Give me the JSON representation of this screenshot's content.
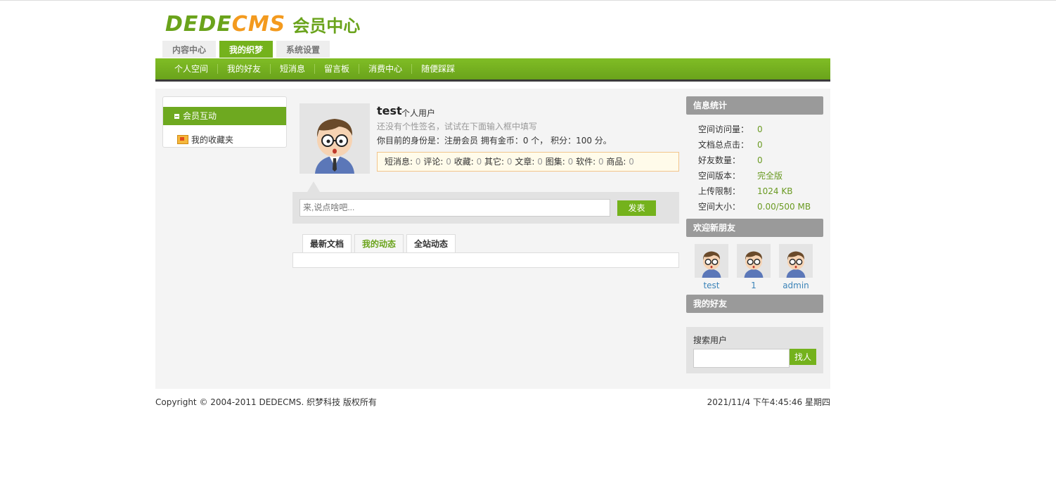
{
  "logo": {
    "part1": "DEDE",
    "part2": "CMS",
    "cn": "会员中心"
  },
  "tabs": [
    {
      "label": "内容中心"
    },
    {
      "label": "我的织梦"
    },
    {
      "label": "系统设置"
    }
  ],
  "subnav": [
    "个人空间",
    "我的好友",
    "短消息",
    "留言板",
    "消费中心",
    "随便踩踩"
  ],
  "left": {
    "section": "会员互动",
    "favorites": "我的收藏夹"
  },
  "profile": {
    "name": "test",
    "type": "个人用户",
    "sign": "还没有个性签名，试试在下面输入框中填写",
    "info": "你目前的身份是：注册会员 拥有金币：0 个，  积分：100 分。",
    "stats": [
      {
        "label": "短消息:",
        "value": "0"
      },
      {
        "label": "评论:",
        "value": "0"
      },
      {
        "label": "收藏:",
        "value": "0"
      },
      {
        "label": "其它:",
        "value": "0"
      },
      {
        "label": "文章:",
        "value": "0"
      },
      {
        "label": "图集:",
        "value": "0"
      },
      {
        "label": "软件:",
        "value": "0"
      },
      {
        "label": "商品:",
        "value": "0"
      }
    ]
  },
  "post": {
    "placeholder": "来,说点啥吧...",
    "button": "发表"
  },
  "content_tabs": [
    {
      "label": "最新文档"
    },
    {
      "label": "我的动态"
    },
    {
      "label": "全站动态"
    }
  ],
  "info_stats": {
    "title": "信息统计",
    "rows": [
      {
        "key": "空间访问量：",
        "value": "0"
      },
      {
        "key": "文档总点击：",
        "value": "0"
      },
      {
        "key": "好友数量：",
        "value": "0"
      },
      {
        "key": "空间版本：",
        "value": "完全版"
      },
      {
        "key": "上传限制：",
        "value": "1024 KB"
      },
      {
        "key": "空间大小：",
        "value": "0.00/500 MB"
      }
    ]
  },
  "new_friends": {
    "title": "欢迎新朋友",
    "items": [
      {
        "name": "test"
      },
      {
        "name": "1"
      },
      {
        "name": "admin"
      }
    ]
  },
  "my_friends": {
    "title": "我的好友"
  },
  "search": {
    "label": "搜索用户",
    "button": "找人"
  },
  "footer": {
    "copyright": "Copyright © 2004-2011 DEDECMS. 织梦科技 版权所有",
    "datetime": "2021/11/4 下午4:45:46 星期四"
  },
  "colors": {
    "accent": "#74b21c",
    "logo_orange": "#f39a1e",
    "panel_gray": "#9a9a9a"
  }
}
